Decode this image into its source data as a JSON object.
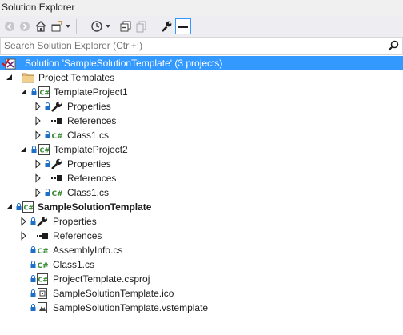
{
  "window": {
    "title": "Solution Explorer"
  },
  "search": {
    "placeholder": "Search Solution Explorer (Ctrl+;)"
  },
  "toolbar": {
    "icons": [
      "back-icon",
      "forward-icon",
      "home-icon",
      "switch-views-icon",
      "history-icon",
      "collapse-all-icon",
      "show-all-files-icon",
      "properties-icon",
      "preview-icon"
    ]
  },
  "tree": {
    "solution": "Solution 'SampleSolutionTemplate' (3 projects)",
    "project_templates_folder": "Project Templates",
    "template_project_1": {
      "name": "TemplateProject1",
      "properties": "Properties",
      "references": "References",
      "class1": "Class1.cs"
    },
    "template_project_2": {
      "name": "TemplateProject2",
      "properties": "Properties",
      "references": "References",
      "class1": "Class1.cs"
    },
    "sample_project": {
      "name": "SampleSolutionTemplate",
      "properties": "Properties",
      "references": "References",
      "assemblyinfo": "AssemblyInfo.cs",
      "class1": "Class1.cs",
      "csproj": "ProjectTemplate.csproj",
      "ico": "SampleSolutionTemplate.ico",
      "vstemplate": "SampleSolutionTemplate.vstemplate"
    }
  },
  "colors": {
    "selection": "#3399ff",
    "csharp_green": "#388a34",
    "lock_blue": "#1e6fc7"
  }
}
